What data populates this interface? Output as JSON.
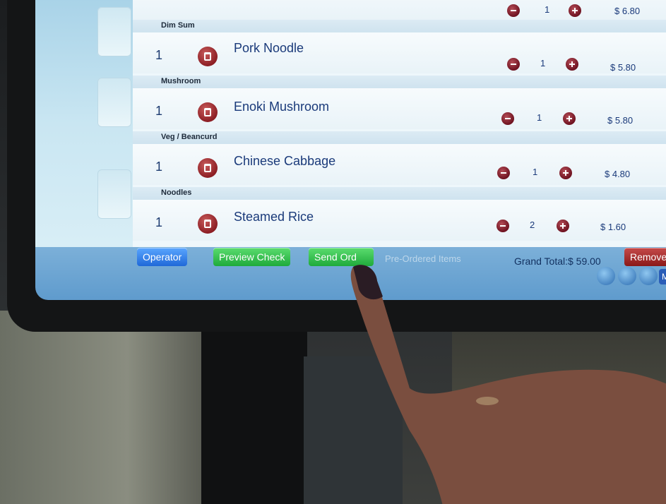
{
  "categories": [
    "Dim Sum",
    "Mushroom",
    "Veg / Beancurd",
    "Noodles"
  ],
  "top_row": {
    "qty": "1",
    "price": "$ 6.80"
  },
  "items": [
    {
      "left_qty": "1",
      "name": "Pork Noodle",
      "qty": "1",
      "price": "$ 5.80"
    },
    {
      "left_qty": "1",
      "name": "Enoki Mushroom",
      "qty": "1",
      "price": "$ 5.80"
    },
    {
      "left_qty": "1",
      "name": "Chinese Cabbage",
      "qty": "1",
      "price": "$ 4.80"
    },
    {
      "left_qty": "1",
      "name": "Steamed Rice",
      "qty": "2",
      "price": "$ 1.60"
    }
  ],
  "toolbar": {
    "operator": "Operator",
    "preview_check": "Preview Check",
    "send_order": "Send Ord",
    "pre_ordered": "Pre-Ordered Items",
    "grand_total": "Grand Total:$ 59.00",
    "remove": "Remove A",
    "my_order": "My O"
  },
  "icons": {
    "trash": "trash-icon",
    "minus": "minus-circle-icon",
    "plus": "plus-circle-icon"
  }
}
